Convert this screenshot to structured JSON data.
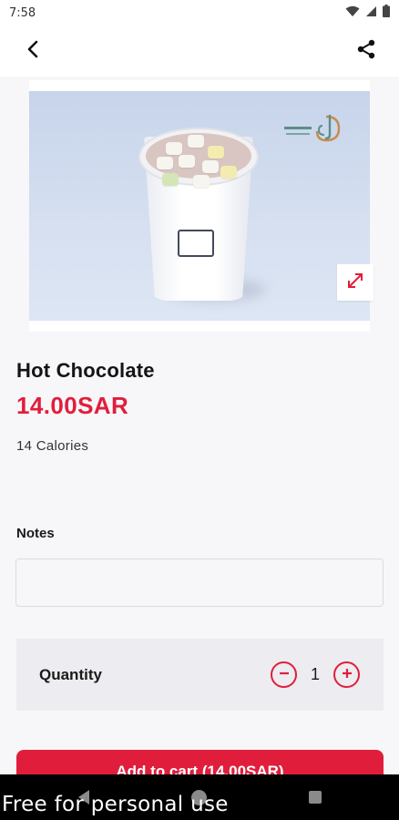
{
  "status_bar": {
    "time": "7:58",
    "wifi_icon": "wifi-icon",
    "signal_icon": "cell-signal-icon",
    "battery_icon": "battery-icon"
  },
  "app_bar": {
    "back_icon": "chevron-left-icon",
    "share_icon": "share-icon"
  },
  "hero": {
    "expand_icon": "expand-icon"
  },
  "product": {
    "title": "Hot Chocolate",
    "price": "14.00SAR",
    "calories": "14 Calories"
  },
  "notes": {
    "label": "Notes",
    "value": "",
    "placeholder": ""
  },
  "quantity": {
    "label": "Quantity",
    "value": "1",
    "decrease_icon": "minus-circle-icon",
    "increase_icon": "plus-circle-icon"
  },
  "cart": {
    "button_label": "Add to cart (14.00SAR)"
  },
  "watermark": {
    "text": "Free for personal use"
  },
  "colors": {
    "accent": "#e01e3c",
    "background": "#f7f6f8",
    "quantity_bg": "#edecf0",
    "nav_bar": "#000000"
  }
}
